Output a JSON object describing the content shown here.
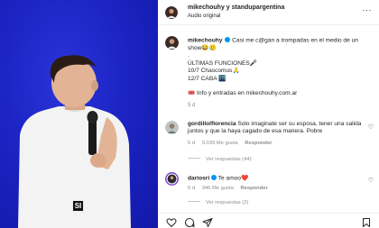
{
  "header": {
    "title": "mikechouhy y standupargentina",
    "subtitle": "Audio original",
    "more": "···"
  },
  "caption": {
    "username": "mikechouhy",
    "line1": "Casi me c@gan a trompadas en el medio de un",
    "line2": "show😂🥲",
    "line3": ".",
    "line4": "ÚLTIMAS FUNCIONES🎤",
    "line5": "10/7 Chascomus🙏",
    "line6": "12/7 CABA 🌃",
    "line7": "🎟️ Info y entradas en mikechouhy.com.ar",
    "time": "5 d"
  },
  "comments": [
    {
      "username": "gordillolflorencia",
      "text": "Solo imaginate ser su esposa, tener una salida juntos y que la haya cagado de esa manera. Pobre",
      "time": "5 d",
      "likes": "9.039 Me gusta",
      "reply": "Responder",
      "view_replies": "Ver respuestas (44)"
    },
    {
      "username": "dariosri",
      "text": "Te amoo❤️",
      "time": "5 d",
      "likes": "346 Me gusta",
      "reply": "Responder",
      "view_replies": "Ver respuestas (2)"
    }
  ],
  "video": {
    "badge": "SI",
    "background_color": "#1c24c4"
  },
  "icons": {
    "like": "heart-icon",
    "comment": "comment-icon",
    "share": "send-icon",
    "save": "bookmark-icon"
  }
}
